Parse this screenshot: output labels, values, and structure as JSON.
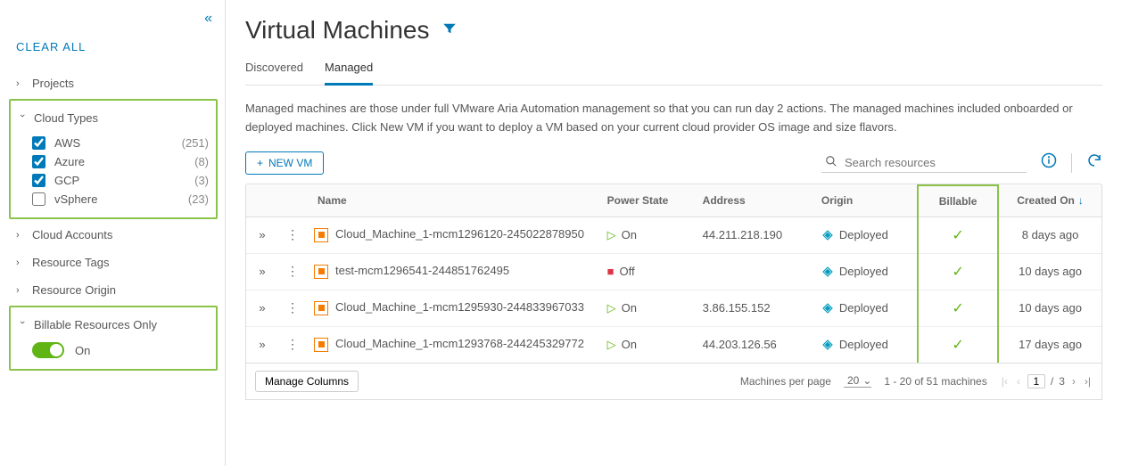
{
  "sidebar": {
    "clear_all": "CLEAR ALL",
    "sections": {
      "projects": {
        "label": "Projects"
      },
      "cloud_types": {
        "label": "Cloud Types",
        "options": [
          {
            "label": "AWS",
            "count": "(251)",
            "checked": true
          },
          {
            "label": "Azure",
            "count": "(8)",
            "checked": true
          },
          {
            "label": "GCP",
            "count": "(3)",
            "checked": true
          },
          {
            "label": "vSphere",
            "count": "(23)",
            "checked": false
          }
        ]
      },
      "cloud_accounts": {
        "label": "Cloud Accounts"
      },
      "resource_tags": {
        "label": "Resource Tags"
      },
      "resource_origin": {
        "label": "Resource Origin"
      },
      "billable": {
        "label": "Billable Resources Only",
        "toggle_label": "On"
      }
    }
  },
  "main": {
    "title": "Virtual Machines",
    "tabs": [
      {
        "label": "Discovered",
        "active": false
      },
      {
        "label": "Managed",
        "active": true
      }
    ],
    "description": "Managed machines are those under full VMware Aria Automation management so that you can run day 2 actions. The managed machines included onboarded or deployed machines. Click New VM if you want to deploy a VM based on your current cloud provider OS image and size flavors.",
    "new_vm_label": "NEW VM",
    "search_placeholder": "Search resources",
    "columns": {
      "name": "Name",
      "power_state": "Power State",
      "address": "Address",
      "origin": "Origin",
      "billable": "Billable",
      "created_on": "Created On"
    },
    "rows": [
      {
        "name": "Cloud_Machine_1-mcm1296120-245022878950",
        "power": "On",
        "address": "44.211.218.190",
        "origin": "Deployed",
        "billable": true,
        "created": "8 days ago"
      },
      {
        "name": "test-mcm1296541-244851762495",
        "power": "Off",
        "address": "",
        "origin": "Deployed",
        "billable": true,
        "created": "10 days ago"
      },
      {
        "name": "Cloud_Machine_1-mcm1295930-244833967033",
        "power": "On",
        "address": "3.86.155.152",
        "origin": "Deployed",
        "billable": true,
        "created": "10 days ago"
      },
      {
        "name": "Cloud_Machine_1-mcm1293768-244245329772",
        "power": "On",
        "address": "44.203.126.56",
        "origin": "Deployed",
        "billable": true,
        "created": "17 days ago"
      }
    ],
    "footer": {
      "manage_columns": "Manage Columns",
      "per_page_label": "Machines per page",
      "per_page_value": "20",
      "range_text": "1 - 20 of 51 machines",
      "current_page": "1",
      "total_pages": "3"
    }
  }
}
